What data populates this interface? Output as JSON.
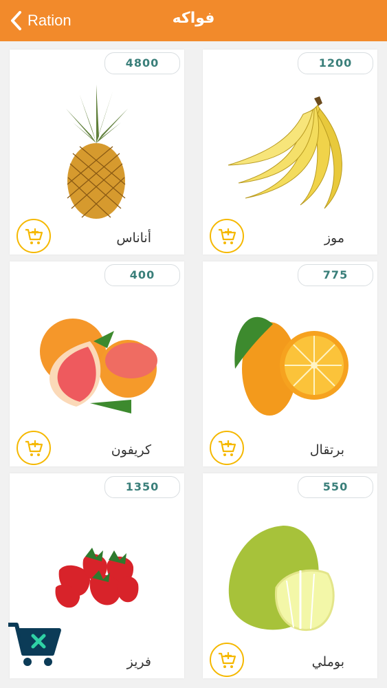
{
  "navbar": {
    "back_label": "Ration",
    "title": "فواكه"
  },
  "products": [
    {
      "name": "موز",
      "price": "1200",
      "icon": "banana-image"
    },
    {
      "name": "أناناس",
      "price": "4800",
      "icon": "pineapple-image"
    },
    {
      "name": "برتقال",
      "price": "775",
      "icon": "orange-image"
    },
    {
      "name": "كريفون",
      "price": "400",
      "icon": "grapefruit-image"
    },
    {
      "name": "بوملي",
      "price": "550",
      "icon": "pomelo-image"
    },
    {
      "name": "فريز",
      "price": "1350",
      "icon": "strawberry-image"
    }
  ],
  "colors": {
    "navbar": "#f28a2b",
    "price_text": "#3a7f7a",
    "cart_ring": "#f5b800",
    "float_cart": "#0b3b57",
    "float_cart_x": "#2fd1a5"
  }
}
